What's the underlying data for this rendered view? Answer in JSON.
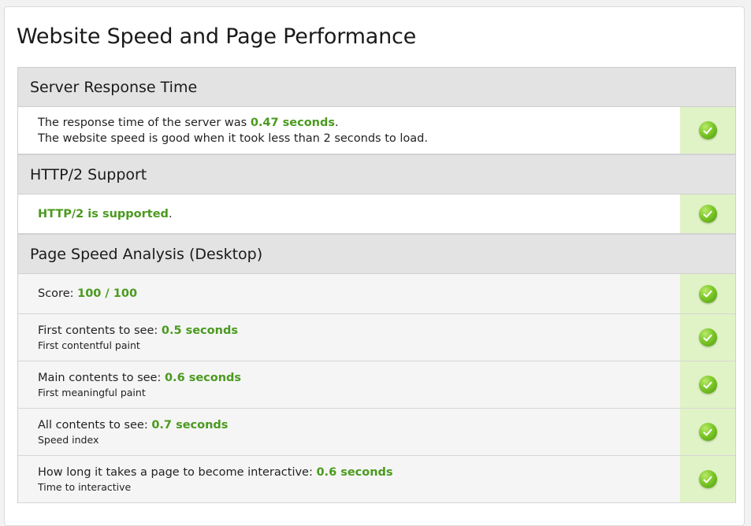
{
  "page": {
    "title": "Website Speed and Page Performance"
  },
  "sections": {
    "server": {
      "header": "Server Response Time",
      "line1_prefix": "The response time of the server was ",
      "line1_value": "0.47 seconds",
      "line1_suffix": ".",
      "line2": "The website speed is good when it took less than 2 seconds to load.",
      "status": "pass"
    },
    "http2": {
      "header": "HTTP/2 Support",
      "value": "HTTP/2 is supported",
      "suffix": ".",
      "status": "pass"
    },
    "pagespeed": {
      "header": "Page Speed Analysis (Desktop)",
      "score_label": "Score: ",
      "score_value": "100 / 100",
      "metrics": [
        {
          "label": "First contents to see: ",
          "value": "0.5 seconds",
          "sub": "First contentful paint",
          "status": "pass"
        },
        {
          "label": "Main contents to see: ",
          "value": "0.6 seconds",
          "sub": "First meaningful paint",
          "status": "pass"
        },
        {
          "label": "All contents to see: ",
          "value": "0.7 seconds",
          "sub": "Speed index",
          "status": "pass"
        },
        {
          "label": "How long it takes a page to become interactive: ",
          "value": "0.6 seconds",
          "sub": "Time to interactive",
          "status": "pass"
        }
      ]
    }
  },
  "icons": {
    "status_pass": "check-circle-icon"
  },
  "colors": {
    "good_text": "#4a9a1e",
    "pass_cell": "#e0f3c6",
    "header_bg": "#e3e3e3"
  }
}
